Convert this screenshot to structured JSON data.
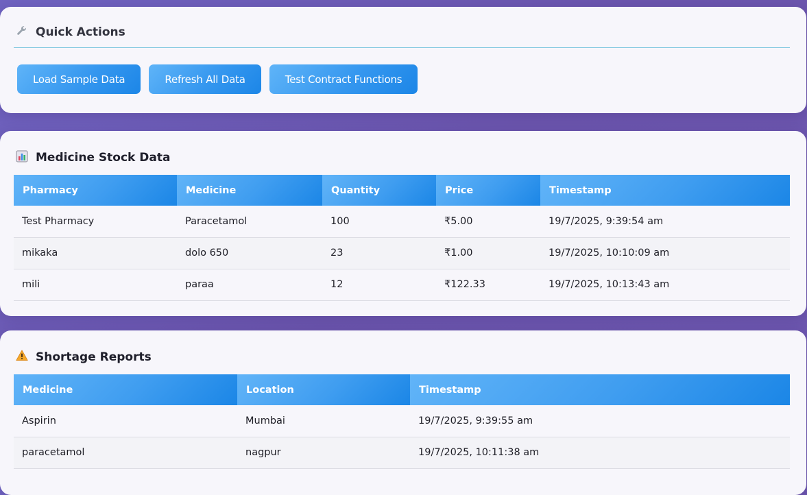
{
  "quick_actions": {
    "icon": "wrench-icon",
    "title": "Quick Actions",
    "buttons": {
      "load_sample": "Load Sample Data",
      "refresh_all": "Refresh All Data",
      "test_contract": "Test Contract Functions"
    }
  },
  "stock": {
    "icon": "bar-chart-icon",
    "title": "Medicine Stock Data",
    "columns": [
      "Pharmacy",
      "Medicine",
      "Quantity",
      "Price",
      "Timestamp"
    ],
    "rows": [
      [
        "Test Pharmacy",
        "Paracetamol",
        "100",
        "₹5.00",
        "19/7/2025, 9:39:54 am"
      ],
      [
        "mikaka",
        "dolo 650",
        "23",
        "₹1.00",
        "19/7/2025, 10:10:09 am"
      ],
      [
        "mili",
        "paraa",
        "12",
        "₹122.33",
        "19/7/2025, 10:13:43 am"
      ]
    ]
  },
  "shortage": {
    "icon": "warning-icon",
    "title": "Shortage Reports",
    "columns": [
      "Medicine",
      "Location",
      "Timestamp"
    ],
    "rows": [
      [
        "Aspirin",
        "Mumbai",
        "19/7/2025, 9:39:55 am"
      ],
      [
        "paracetamol",
        "nagpur",
        "19/7/2025, 10:11:38 am"
      ]
    ]
  },
  "colors": {
    "background": "#6b5ab5",
    "card": "#f7f6fb",
    "accent": "#2e93ee",
    "divider": "#7fc7df"
  }
}
